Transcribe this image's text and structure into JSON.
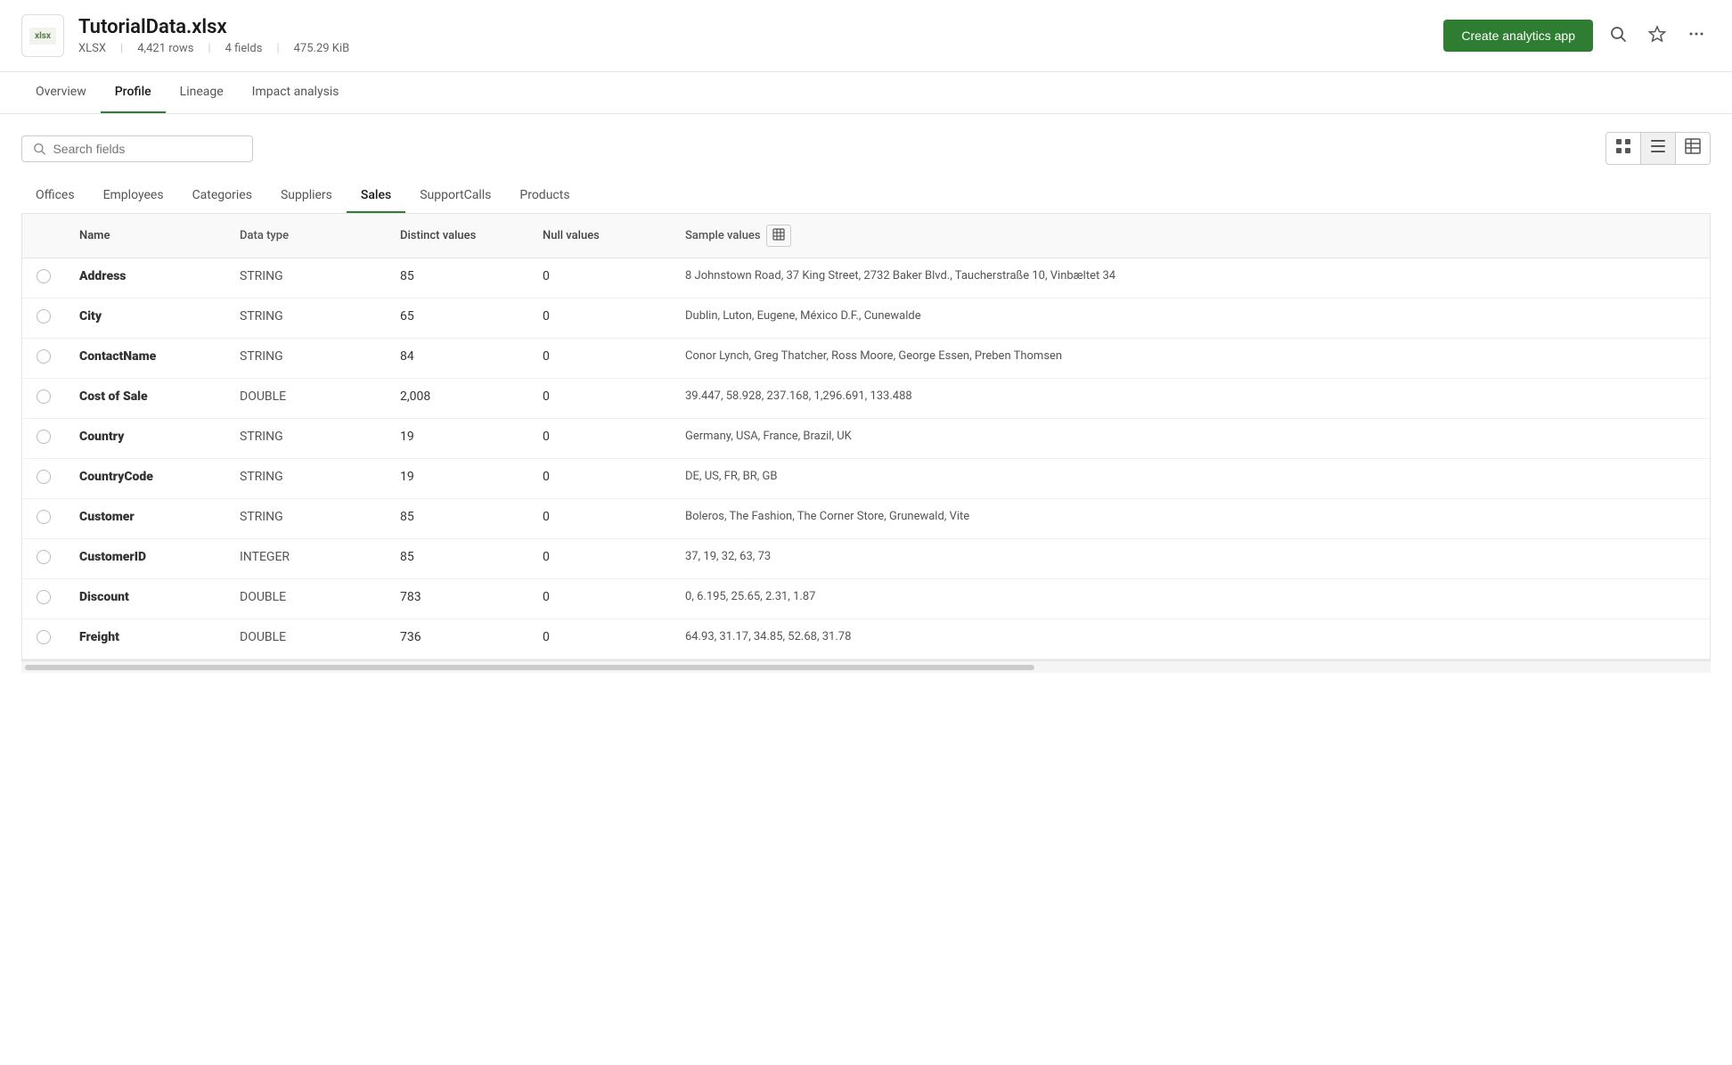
{
  "header": {
    "filename": "TutorialData.xlsx",
    "filetype": "XLSX",
    "rows": "4,421 rows",
    "fields": "4 fields",
    "filesize": "475.29 KiB",
    "create_btn": "Create analytics app",
    "file_icon_label": "xlsx"
  },
  "tabs": [
    {
      "id": "overview",
      "label": "Overview",
      "active": false
    },
    {
      "id": "profile",
      "label": "Profile",
      "active": true
    },
    {
      "id": "lineage",
      "label": "Lineage",
      "active": false
    },
    {
      "id": "impact",
      "label": "Impact analysis",
      "active": false
    }
  ],
  "search": {
    "placeholder": "Search fields"
  },
  "sheet_tabs": [
    {
      "id": "offices",
      "label": "Offices",
      "active": false
    },
    {
      "id": "employees",
      "label": "Employees",
      "active": false
    },
    {
      "id": "categories",
      "label": "Categories",
      "active": false
    },
    {
      "id": "suppliers",
      "label": "Suppliers",
      "active": false
    },
    {
      "id": "sales",
      "label": "Sales",
      "active": true
    },
    {
      "id": "supportcalls",
      "label": "SupportCalls",
      "active": false
    },
    {
      "id": "products",
      "label": "Products",
      "active": false
    }
  ],
  "table": {
    "columns": [
      {
        "id": "select",
        "label": ""
      },
      {
        "id": "name",
        "label": "Name"
      },
      {
        "id": "datatype",
        "label": "Data type"
      },
      {
        "id": "distinct",
        "label": "Distinct values"
      },
      {
        "id": "null",
        "label": "Null values"
      },
      {
        "id": "sample",
        "label": "Sample values"
      }
    ],
    "rows": [
      {
        "name": "Address",
        "datatype": "STRING",
        "distinct": "85",
        "null": "0",
        "sample": "8 Johnstown Road, 37 King Street, 2732 Baker Blvd., Taucherstraße 10, Vinbæltet 34"
      },
      {
        "name": "City",
        "datatype": "STRING",
        "distinct": "65",
        "null": "0",
        "sample": "Dublin, Luton, Eugene, México D.F., Cunewalde"
      },
      {
        "name": "ContactName",
        "datatype": "STRING",
        "distinct": "84",
        "null": "0",
        "sample": "Conor Lynch, Greg Thatcher, Ross Moore, George Essen, Preben Thomsen"
      },
      {
        "name": "Cost of Sale",
        "datatype": "DOUBLE",
        "distinct": "2,008",
        "null": "0",
        "sample": "39.447, 58.928, 237.168, 1,296.691, 133.488"
      },
      {
        "name": "Country",
        "datatype": "STRING",
        "distinct": "19",
        "null": "0",
        "sample": "Germany, USA, France, Brazil, UK"
      },
      {
        "name": "CountryCode",
        "datatype": "STRING",
        "distinct": "19",
        "null": "0",
        "sample": "DE, US, FR, BR, GB"
      },
      {
        "name": "Customer",
        "datatype": "STRING",
        "distinct": "85",
        "null": "0",
        "sample": "Boleros, The Fashion, The Corner Store, Grunewald, Vite"
      },
      {
        "name": "CustomerID",
        "datatype": "INTEGER",
        "distinct": "85",
        "null": "0",
        "sample": "37, 19, 32, 63, 73"
      },
      {
        "name": "Discount",
        "datatype": "DOUBLE",
        "distinct": "783",
        "null": "0",
        "sample": "0, 6.195, 25.65, 2.31, 1.87"
      },
      {
        "name": "Freight",
        "datatype": "DOUBLE",
        "distinct": "736",
        "null": "0",
        "sample": "64.93, 31.17, 34.85, 52.68, 31.78"
      }
    ]
  }
}
